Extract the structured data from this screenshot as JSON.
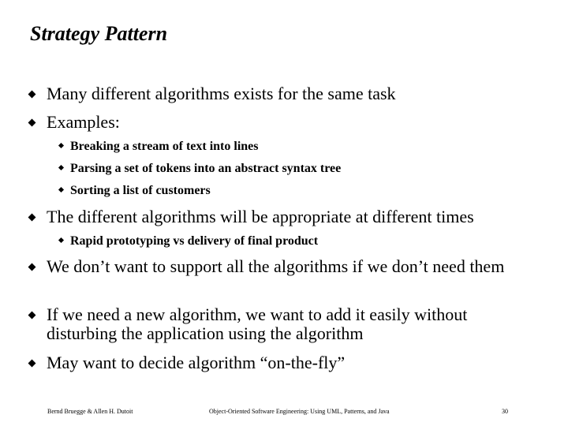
{
  "slide": {
    "title": "Strategy Pattern",
    "bullets": [
      "Many different algorithms exists for the same task",
      "Examples:",
      "The different algorithms will be appropriate at different times",
      "We don’t want to support all the algorithms if we don’t need them",
      "If we need a new algorithm, we want to add it easily without disturbing the application using the algorithm",
      "May want to decide algorithm “on-the-fly”"
    ],
    "sub_bullets_examples": [
      "Breaking a stream of text into lines",
      "Parsing a set of tokens into an abstract syntax tree",
      "Sorting a list of customers"
    ],
    "sub_bullets_times": [
      "Rapid prototyping vs delivery of final product"
    ]
  },
  "footer": {
    "authors": "Bernd Bruegge & Allen H. Dutoit",
    "book": "Object-Oriented Software Engineering: Using UML, Patterns, and Java",
    "page": "30"
  }
}
